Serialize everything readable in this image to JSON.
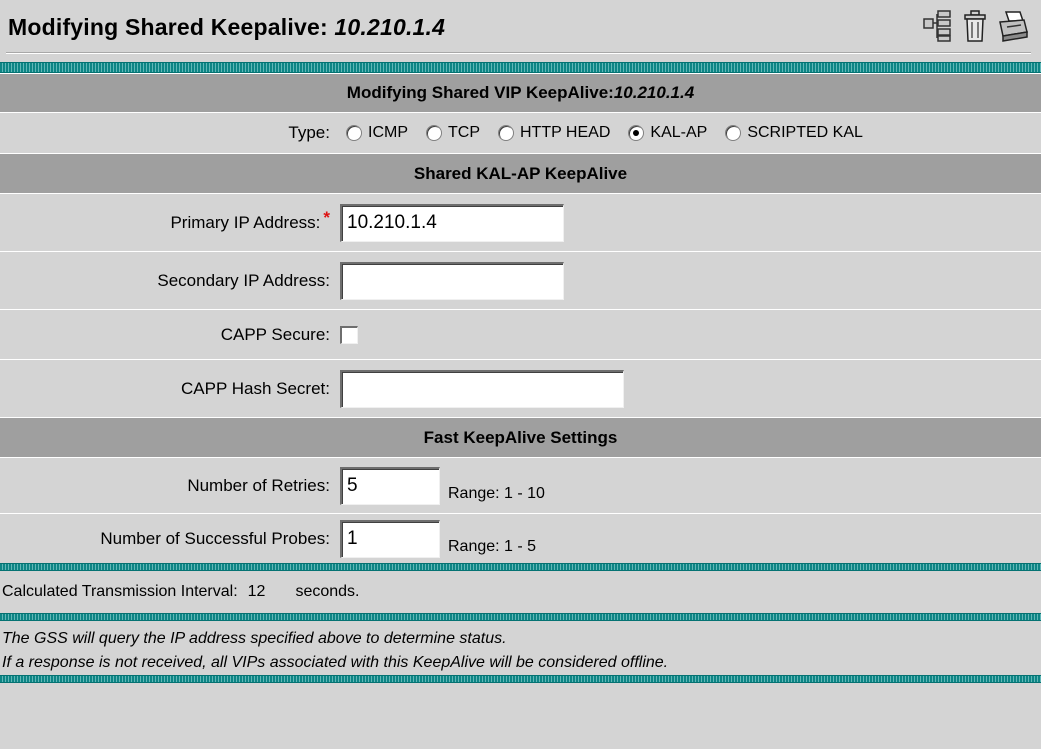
{
  "header": {
    "title_prefix": "Modifying Shared Keepalive: ",
    "title_ip": "10.210.1.4",
    "icons": [
      "tree-icon",
      "trash-icon",
      "print-icon"
    ]
  },
  "section_main": {
    "title_prefix": "Modifying Shared VIP KeepAlive: ",
    "title_ip": "10.210.1.4"
  },
  "type_row": {
    "label": "Type:",
    "options": [
      "ICMP",
      "TCP",
      "HTTP HEAD",
      "KAL-AP",
      "SCRIPTED KAL"
    ],
    "selected": "KAL-AP"
  },
  "section_kalap": {
    "title": "Shared KAL-AP KeepAlive"
  },
  "primary_ip": {
    "label": "Primary IP Address:",
    "required_mark": "*",
    "value": "10.210.1.4"
  },
  "secondary_ip": {
    "label": "Secondary IP Address:",
    "value": ""
  },
  "capp_secure": {
    "label": "CAPP Secure:",
    "checked": false
  },
  "capp_hash": {
    "label": "CAPP Hash Secret:",
    "value": ""
  },
  "section_fast": {
    "title": "Fast KeepAlive Settings"
  },
  "retries": {
    "label": "Number of Retries:",
    "value": "5",
    "range": "Range: 1 - 10"
  },
  "probes": {
    "label": "Number of Successful Probes:",
    "value": "1",
    "range": "Range: 1 - 5"
  },
  "calc": {
    "label": "Calculated Transmission Interval:",
    "value": "12",
    "unit": "seconds."
  },
  "note": {
    "line1": "The GSS will query the IP address specified above to determine status.",
    "line2": "If a response is not received, all VIPs associated with this KeepAlive will be considered offline."
  },
  "colors": {
    "stripe": "#0e8585",
    "section_bg": "#9f9f9f",
    "page_bg": "#d4d4d4",
    "required": "#dd1111"
  }
}
